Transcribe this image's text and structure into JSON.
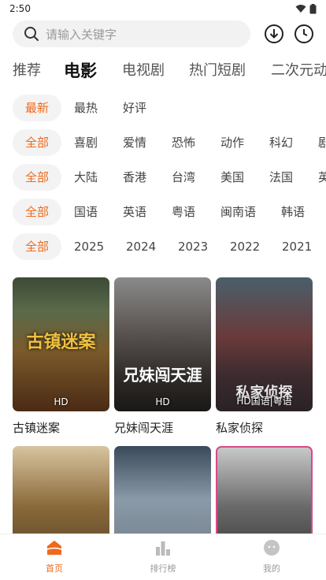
{
  "status_bar": {
    "time": "2:50"
  },
  "search": {
    "placeholder": "请输入关键字"
  },
  "channels": [
    "推荐",
    "电影",
    "电视剧",
    "热门短剧",
    "二次元动"
  ],
  "channel_active": "电影",
  "sort_filter": [
    "最新",
    "最热",
    "好评"
  ],
  "genre_filter": [
    "全部",
    "喜剧",
    "爱情",
    "恐怖",
    "动作",
    "科幻",
    "剧"
  ],
  "region_filter": [
    "全部",
    "大陆",
    "香港",
    "台湾",
    "美国",
    "法国",
    "英"
  ],
  "language_filter": [
    "全部",
    "国语",
    "英语",
    "粤语",
    "闽南语",
    "韩语"
  ],
  "year_filter": [
    "全部",
    "2025",
    "2024",
    "2023",
    "2022",
    "2021"
  ],
  "movies": [
    {
      "title": "古镇迷案",
      "tag": "HD",
      "art_text": "古镇迷案"
    },
    {
      "title": "兄妹闯天涯",
      "tag": "HD",
      "art_text": "兄妹闯天涯"
    },
    {
      "title": "私家侦探",
      "tag": "HD国语|粤语",
      "art_text": "私家侦探"
    }
  ],
  "bottom_nav": [
    "首页",
    "排行榜",
    "我的"
  ],
  "colors": {
    "accent": "#ee6a1d",
    "chip_bg": "#f3f3f3"
  }
}
